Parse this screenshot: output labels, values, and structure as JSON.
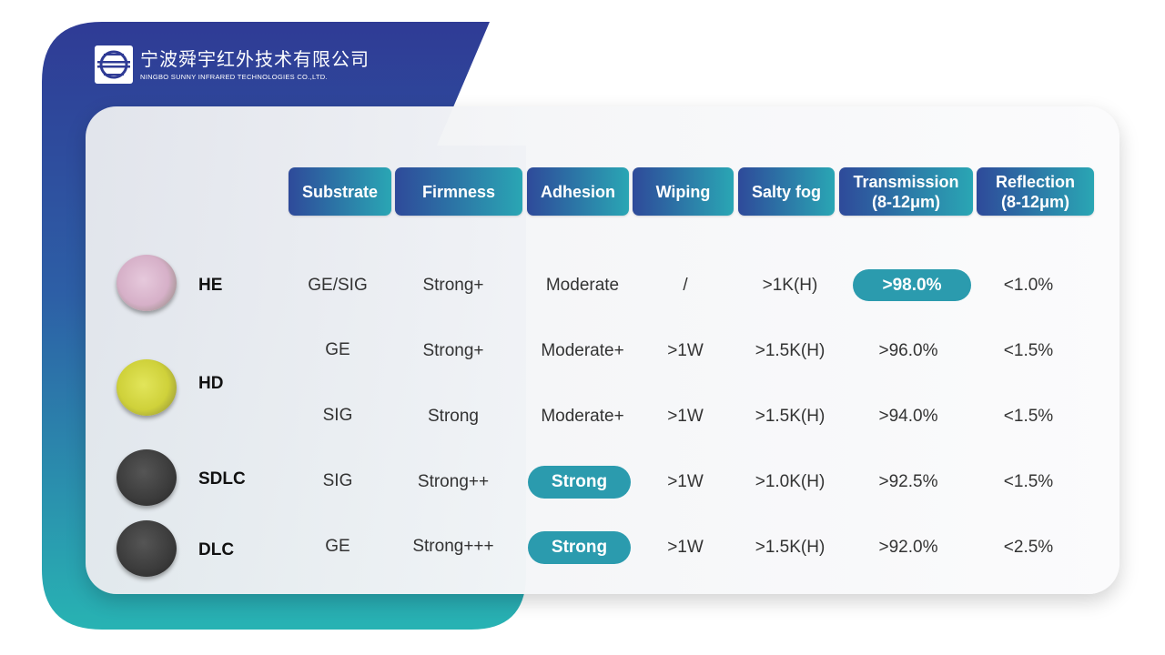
{
  "company": {
    "name_cn": "宁波舜宇红外技术有限公司",
    "name_en": "NINGBO SUNNY INFRARED TECHNOLOGIES CO.,LTD."
  },
  "colors": {
    "brand_dark": "#2e3e96",
    "brand_teal": "#2ab2b2",
    "highlight": "#2b9bae"
  },
  "headers": [
    {
      "line1": "Substrate",
      "line2": ""
    },
    {
      "line1": "Firmness",
      "line2": ""
    },
    {
      "line1": "Adhesion",
      "line2": ""
    },
    {
      "line1": "Wiping",
      "line2": ""
    },
    {
      "line1": "Salty fog",
      "line2": ""
    },
    {
      "line1": "Transmission",
      "line2": "(8-12μm)"
    },
    {
      "line1": "Reflection",
      "line2": "(8-12μm)"
    }
  ],
  "coatings": [
    {
      "name": "HE",
      "lens_color": "pink"
    },
    {
      "name": "HD",
      "lens_color": "yellow"
    },
    {
      "name": "SDLC",
      "lens_color": "black"
    },
    {
      "name": "DLC",
      "lens_color": "black"
    }
  ],
  "rows": [
    {
      "coating": "HE",
      "cells": [
        "GE/SIG",
        "Strong+",
        "Moderate",
        "/",
        ">1K(H)",
        ">98.0%",
        "<1.0%"
      ]
    },
    {
      "coating": "HD",
      "cells": [
        "GE",
        "Strong+",
        "Moderate+",
        ">1W",
        ">1.5K(H)",
        ">96.0%",
        "<1.5%"
      ]
    },
    {
      "coating": "HD",
      "cells": [
        "SIG",
        "Strong",
        "Moderate+",
        ">1W",
        ">1.5K(H)",
        ">94.0%",
        "<1.5%"
      ]
    },
    {
      "coating": "SDLC",
      "cells": [
        "SIG",
        "Strong++",
        "Strong",
        ">1W",
        ">1.0K(H)",
        ">92.5%",
        "<1.5%"
      ]
    },
    {
      "coating": "DLC",
      "cells": [
        "GE",
        "Strong+++",
        "Strong",
        ">1W",
        ">1.5K(H)",
        ">92.0%",
        "<2.5%"
      ]
    }
  ]
}
